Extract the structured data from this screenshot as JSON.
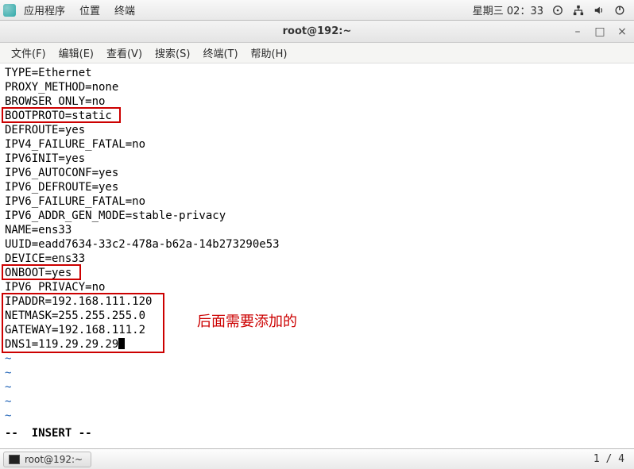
{
  "top_panel": {
    "app_menu": "应用程序",
    "places": "位置",
    "terminal": "终端",
    "datetime": "星期三 02：33"
  },
  "window": {
    "title": "root@192:~"
  },
  "menubar": {
    "file": "文件(F)",
    "edit": "编辑(E)",
    "view": "查看(V)",
    "search": "搜索(S)",
    "terminal": "终端(T)",
    "help": "帮助(H)"
  },
  "file_lines": [
    "TYPE=Ethernet",
    "PROXY_METHOD=none",
    "BROWSER_ONLY=no",
    "BOOTPROTO=static",
    "DEFROUTE=yes",
    "IPV4_FAILURE_FATAL=no",
    "IPV6INIT=yes",
    "IPV6_AUTOCONF=yes",
    "IPV6_DEFROUTE=yes",
    "IPV6_FAILURE_FATAL=no",
    "IPV6_ADDR_GEN_MODE=stable-privacy",
    "NAME=ens33",
    "UUID=eadd7634-33c2-478a-b62a-14b273290e53",
    "DEVICE=ens33",
    "ONBOOT=yes",
    "IPV6_PRIVACY=no",
    "IPADDR=192.168.111.120",
    "NETMASK=255.255.255.0",
    "GATEWAY=192.168.111.2",
    "DNS1=119.29.29.29"
  ],
  "annotation": "后面需要添加的",
  "vim_status": "--  INSERT --",
  "taskbar": {
    "label": "root@192:~"
  },
  "pager": "1 / 4"
}
